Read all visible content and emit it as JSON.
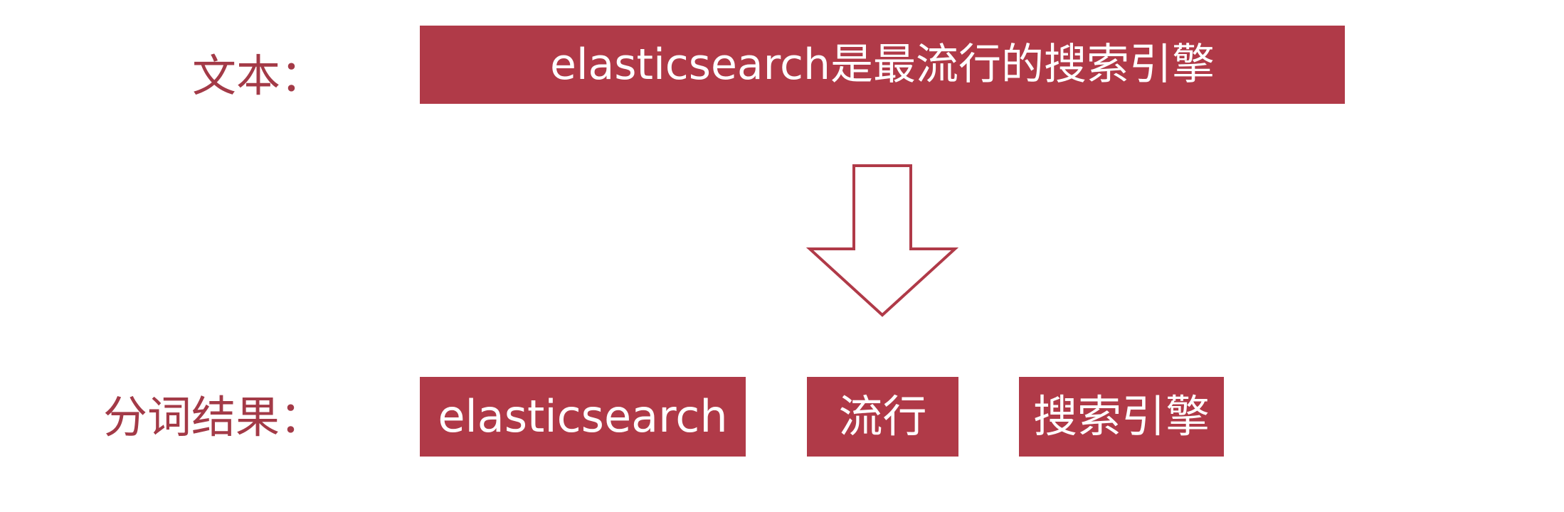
{
  "diagram": {
    "text_label": "文本：",
    "input_text": "elasticsearch是最流行的搜索引擎",
    "result_label": "分词结果：",
    "tokens": [
      "elasticsearch",
      "流行",
      "搜索引擎"
    ]
  },
  "colors": {
    "box_fill": "#b03a48",
    "label_text": "#a33a47",
    "arrow_stroke": "#b03a48"
  }
}
